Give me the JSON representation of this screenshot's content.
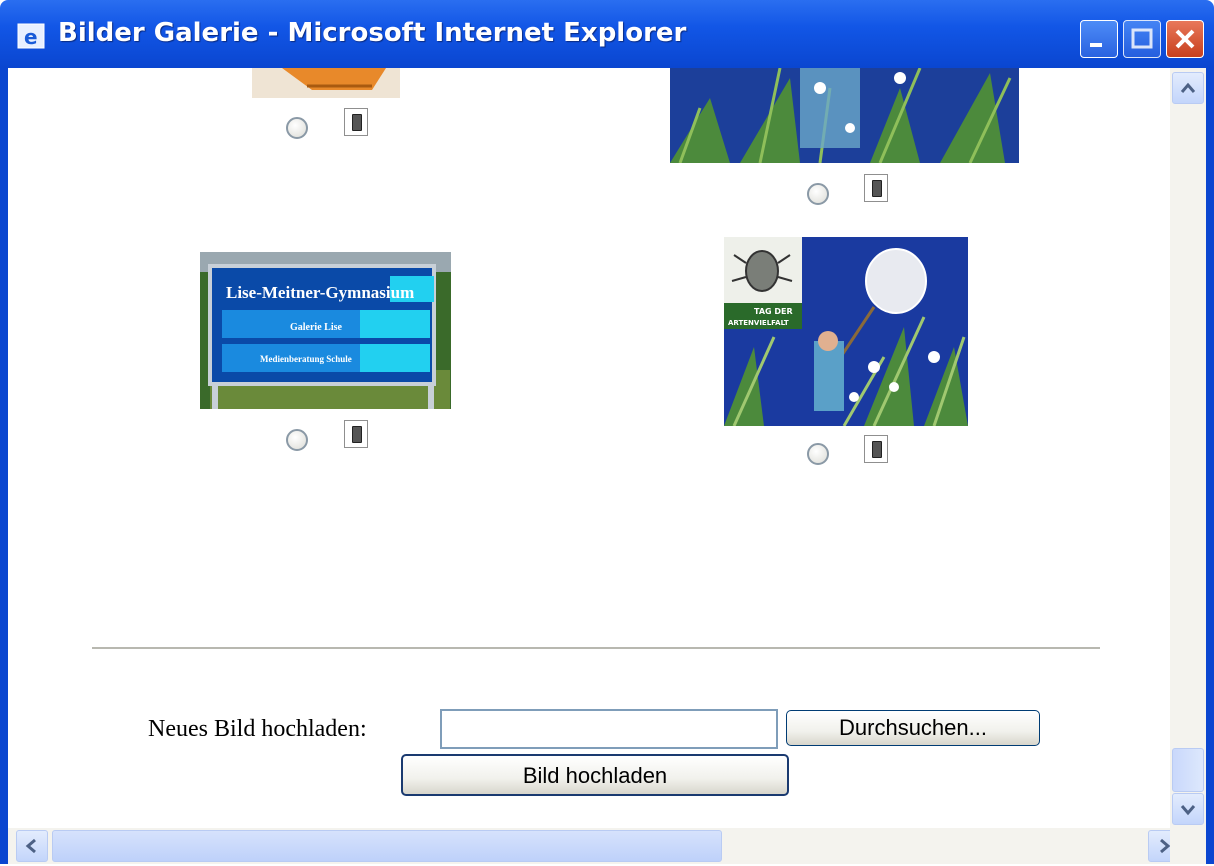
{
  "window": {
    "title": "Bilder Galerie - Microsoft Internet Explorer"
  },
  "gallery": {
    "items": [
      {
        "name": "tile-orange"
      },
      {
        "name": "tile-meadow-top"
      },
      {
        "name": "tile-sign"
      },
      {
        "name": "tile-beetle-net"
      }
    ],
    "sign_text": [
      "Lise-Meitner-Gymnasium",
      "Galerie Lise",
      "Medienberatung Schule"
    ],
    "poster_text": [
      "TAG DER",
      "ARTENVIELFALT"
    ]
  },
  "upload": {
    "label": "Neues Bild hochladen:",
    "file_value": "",
    "browse_label": "Durchsuchen...",
    "submit_label": "Bild hochladen"
  },
  "colors": {
    "titlebar": "#0a46d0",
    "button_border": "#003c74"
  }
}
